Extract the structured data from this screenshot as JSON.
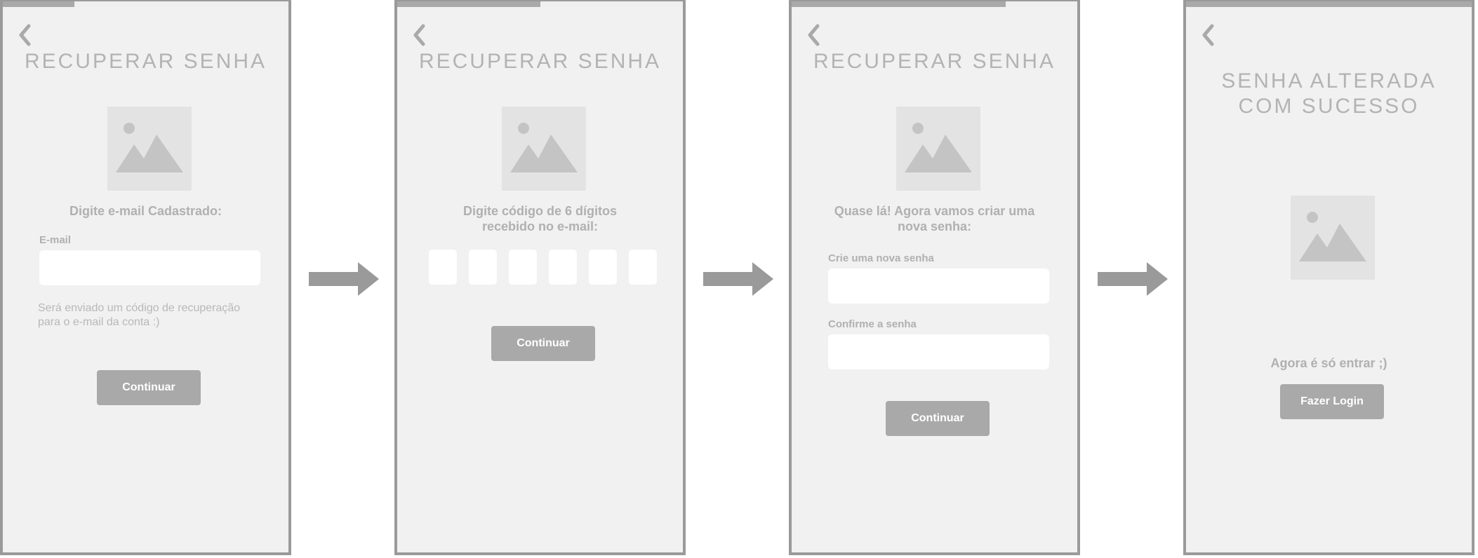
{
  "flow": {
    "arrow_icon": "arrow-right-icon",
    "colors": {
      "frame_border": "#9a9a9a",
      "screen_background": "#f1f1f1",
      "button": "#a9a9a9",
      "text_muted": "#b0b0b0",
      "arrow": "#9a9a9a"
    }
  },
  "screen1": {
    "progress": 0.25,
    "back_icon": "chevron-left-icon",
    "title": "RECUPERAR SENHA",
    "image_icon": "image-placeholder-icon",
    "prompt": "Digite e-mail Cadastrado:",
    "email_label": "E-mail",
    "email_value": "",
    "hint": "Será enviado um código de recuperação\npara o e-mail da conta :)",
    "button_label": "Continuar"
  },
  "screen2": {
    "progress": 0.5,
    "back_icon": "chevron-left-icon",
    "title": "RECUPERAR SENHA",
    "image_icon": "image-placeholder-icon",
    "prompt": "Digite código de 6 dígitos\nrecebido no e-mail:",
    "code_digits": [
      "",
      "",
      "",
      "",
      "",
      ""
    ],
    "button_label": "Continuar"
  },
  "screen3": {
    "progress": 0.75,
    "back_icon": "chevron-left-icon",
    "title": "RECUPERAR SENHA",
    "image_icon": "image-placeholder-icon",
    "prompt": "Quase lá! Agora vamos criar uma\nnova senha:",
    "new_password_label": "Crie uma nova senha",
    "new_password_value": "",
    "confirm_password_label": "Confirme a senha",
    "confirm_password_value": "",
    "button_label": "Continuar"
  },
  "screen4": {
    "progress": 1.0,
    "back_icon": "chevron-left-icon",
    "title": "SENHA ALTERADA\nCOM SUCESSO",
    "image_icon": "image-placeholder-icon",
    "message": "Agora é só entrar ;)",
    "button_label": "Fazer Login"
  }
}
